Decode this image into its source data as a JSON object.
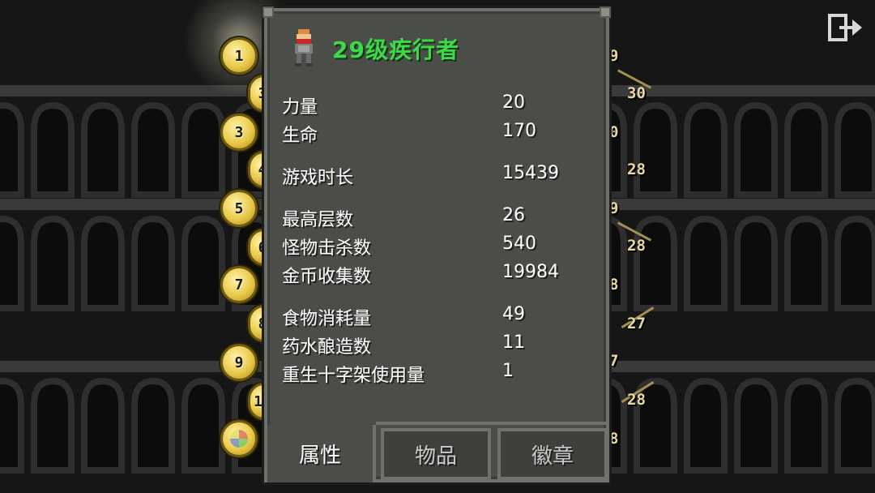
{
  "hero": {
    "title": "29级疾行者",
    "sprite_icon": "huntress-sprite-icon"
  },
  "stats": [
    {
      "label": "力量",
      "value": "20"
    },
    {
      "label": "生命",
      "value": "170"
    },
    {
      "label": "游戏时长",
      "value": "15439"
    },
    {
      "label": "最高层数",
      "value": "26"
    },
    {
      "label": "怪物击杀数",
      "value": "540"
    },
    {
      "label": "金币收集数",
      "value": "19984"
    },
    {
      "label": "食物消耗量",
      "value": "49"
    },
    {
      "label": "药水酿造数",
      "value": "11"
    },
    {
      "label": "重生十字架使用量",
      "value": "1"
    }
  ],
  "tabs": {
    "stats": "属性",
    "items": "物品",
    "badges": "徽章",
    "active": "stats"
  },
  "medals": [
    {
      "label": "1"
    },
    {
      "label": "3"
    },
    {
      "label": "3"
    },
    {
      "label": "4"
    },
    {
      "label": "5"
    },
    {
      "label": "6"
    },
    {
      "label": "7"
    },
    {
      "label": "8"
    },
    {
      "label": "9"
    },
    {
      "label": "10"
    },
    {
      "label": ""
    }
  ],
  "depths": [
    {
      "label": "9"
    },
    {
      "label": "30"
    },
    {
      "label": "0"
    },
    {
      "label": "28"
    },
    {
      "label": "9"
    },
    {
      "label": "28"
    },
    {
      "label": "8"
    },
    {
      "label": "27"
    },
    {
      "label": "7"
    },
    {
      "label": "28"
    },
    {
      "label": "8"
    }
  ],
  "colors": {
    "title_green": "#3fd84a",
    "panel_bg": "#4b4d48",
    "panel_border": "#6f716b",
    "medal_gold": "#e9c94a"
  },
  "icons": {
    "exit": "exit-icon"
  }
}
